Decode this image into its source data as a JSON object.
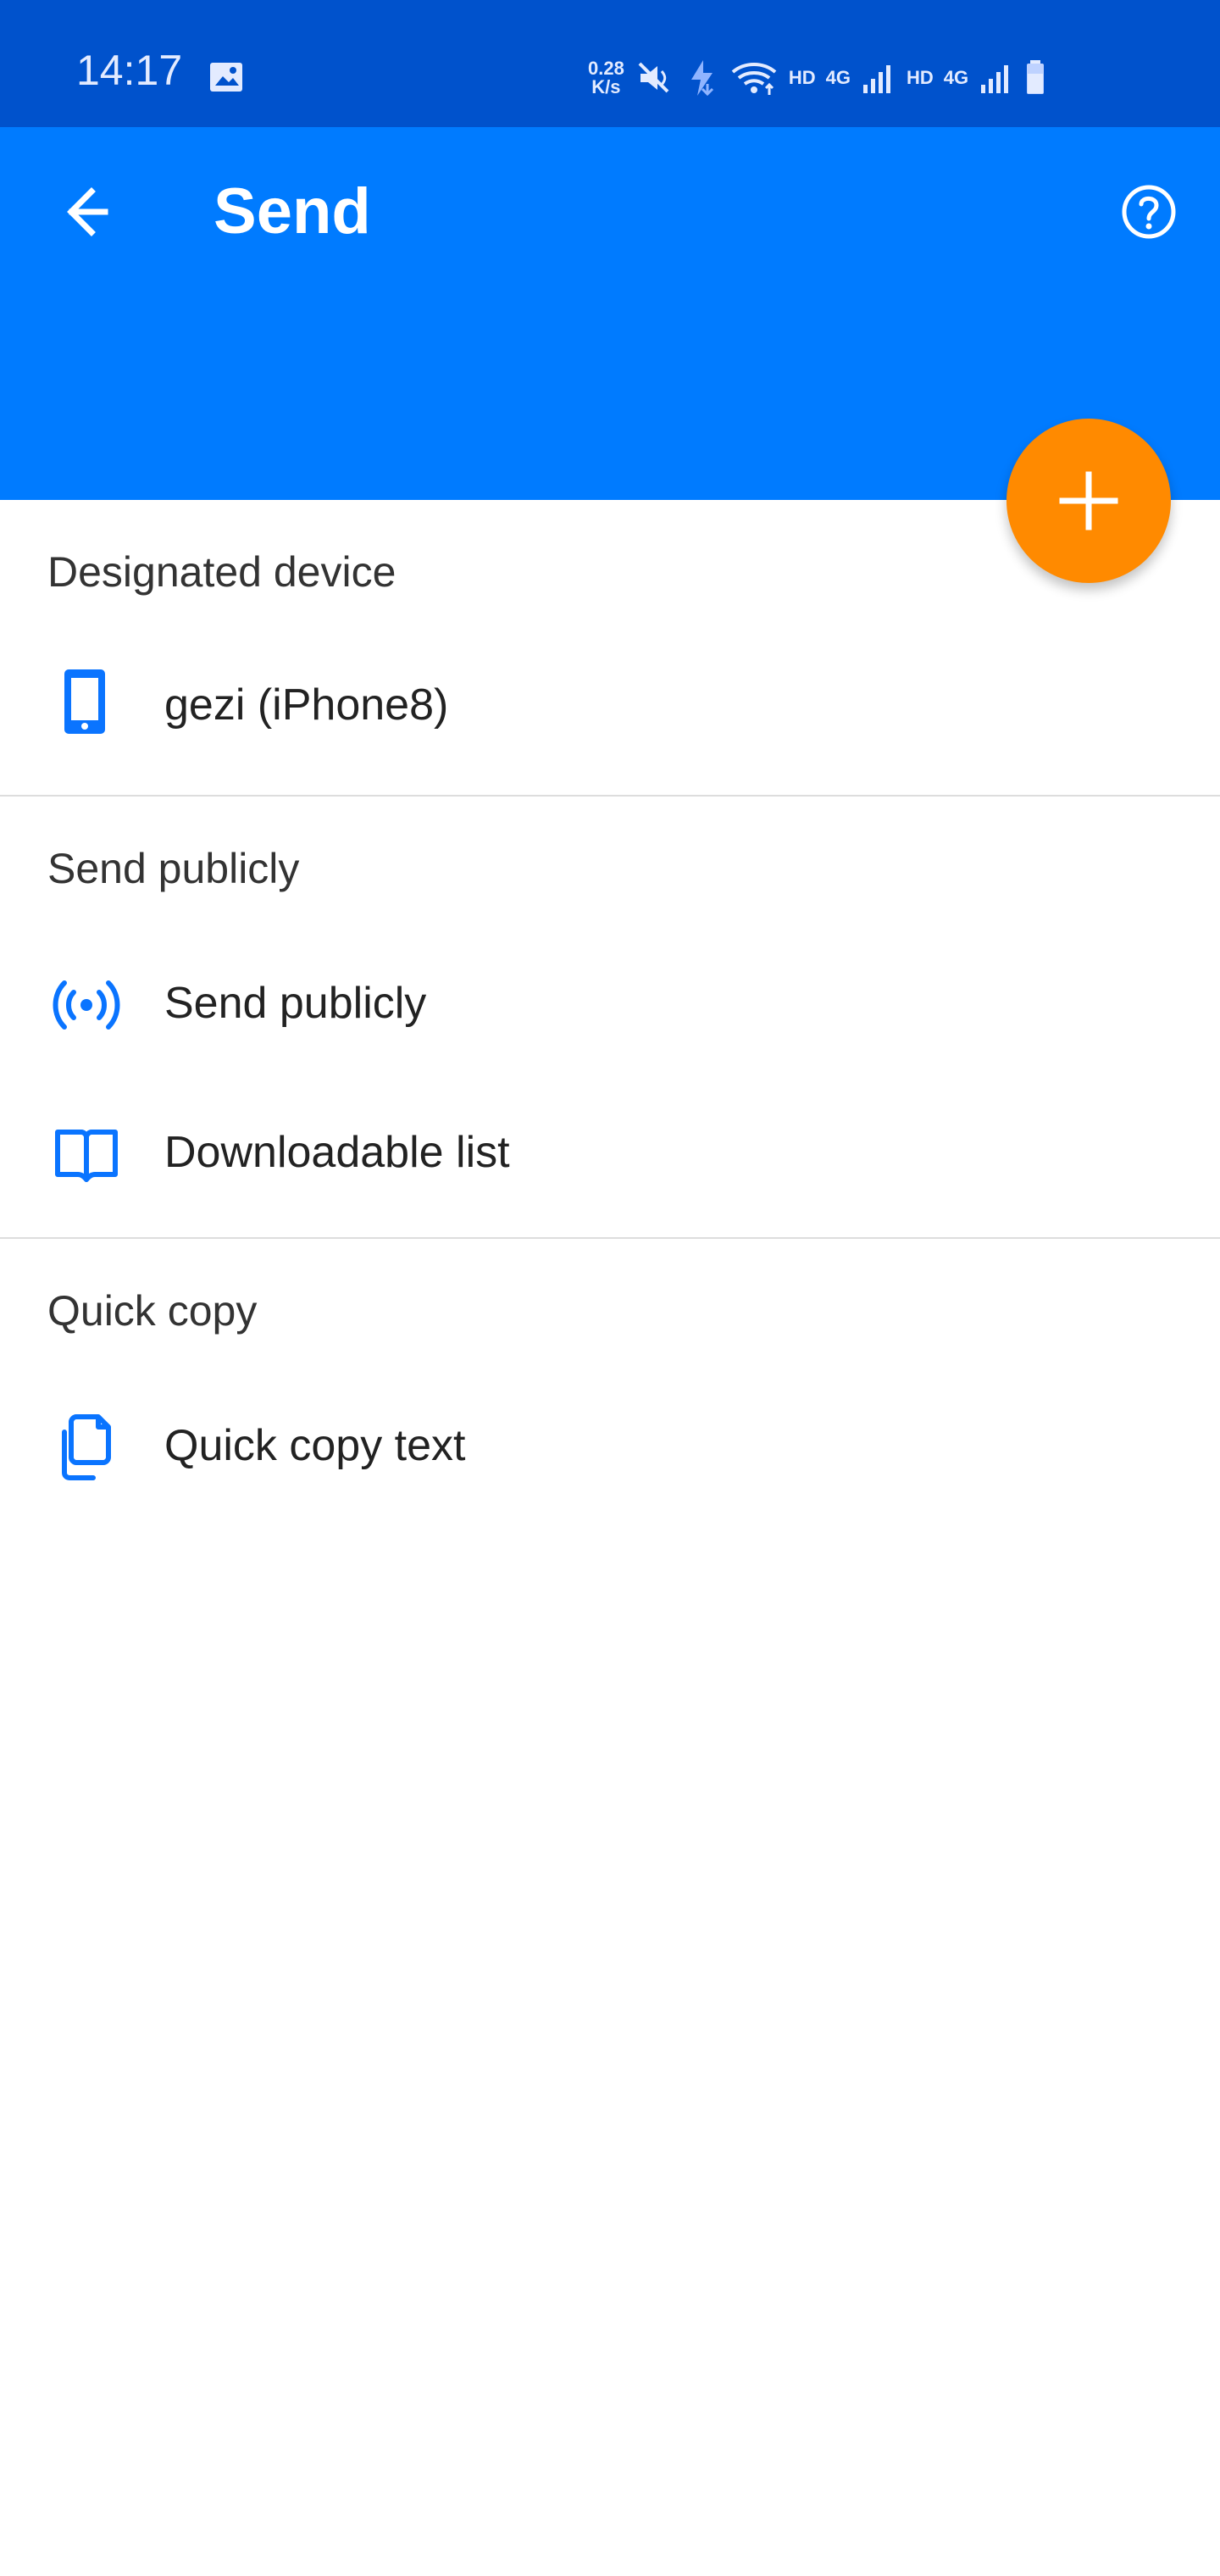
{
  "status_bar": {
    "time": "14:17",
    "speed_value": "0.28",
    "speed_unit": "K/s",
    "network_label_1": "HD",
    "network_label_2": "4G",
    "network_label_3": "HD",
    "network_label_4": "4G",
    "icons": [
      "gallery-icon",
      "mute-icon",
      "charging-icon",
      "wifi-icon",
      "signal-icon",
      "battery-icon"
    ]
  },
  "app_bar": {
    "title": "Send",
    "back_icon": "back-icon",
    "help_icon": "help-icon",
    "background_color": "#007bff"
  },
  "fab": {
    "icon": "add-icon",
    "color": "#ff8a00"
  },
  "sections": {
    "designated_device": {
      "title": "Designated device",
      "items": [
        {
          "label": "gezi (iPhone8)",
          "icon": "phone-icon"
        }
      ]
    },
    "send_publicly": {
      "title": "Send publicly",
      "items": [
        {
          "label": "Send publicly",
          "icon": "broadcast-icon"
        },
        {
          "label": "Downloadable list",
          "icon": "book-icon"
        }
      ]
    },
    "quick_copy": {
      "title": "Quick copy",
      "items": [
        {
          "label": "Quick copy text",
          "icon": "copy-icon"
        }
      ]
    }
  },
  "colors": {
    "accent": "#0a74ff",
    "status_bar": "#0052cc",
    "divider": "#dddddd"
  }
}
